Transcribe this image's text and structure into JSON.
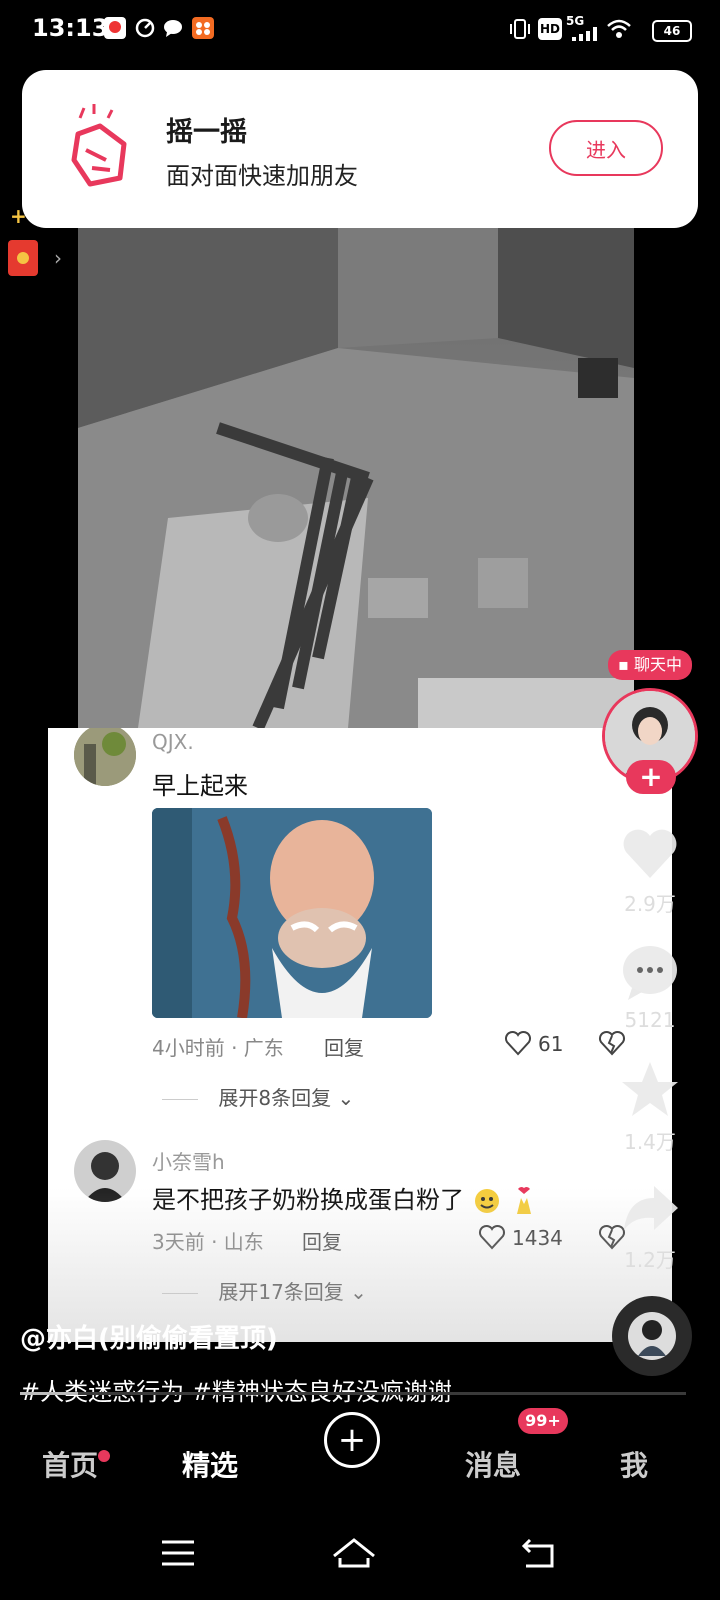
{
  "status_bar": {
    "time": "13:13",
    "network": "5G",
    "battery": "46"
  },
  "banner": {
    "title": "摇一摇",
    "subtitle": "面对面快速加朋友",
    "button": "进入"
  },
  "chat_badge": "聊天中",
  "actions": {
    "likes": "2.9万",
    "comments": "5121",
    "favorites": "1.4万",
    "shares": "1.2万"
  },
  "comments": [
    {
      "user": "QJX.",
      "text": "早上起来",
      "meta": "4小时前 · 广东",
      "reply": "回复",
      "likes": "61",
      "expand": "展开8条回复"
    },
    {
      "user": "小奈雪h",
      "text": "是不把孩子奶粉换成蛋白粉了",
      "meta": "3天前 · 山东",
      "reply": "回复",
      "likes": "1434",
      "expand": "展开17条回复"
    }
  ],
  "caption": {
    "author": "@亦白(别偷偷看置顶)",
    "tags": "#人类迷惑行为 #精神状态良好没疯谢谢"
  },
  "nav": {
    "home": "首页",
    "featured": "精选",
    "messages": "消息",
    "messages_badge": "99+",
    "me": "我"
  },
  "colors": {
    "accent": "#e8385c",
    "background": "#000000"
  }
}
